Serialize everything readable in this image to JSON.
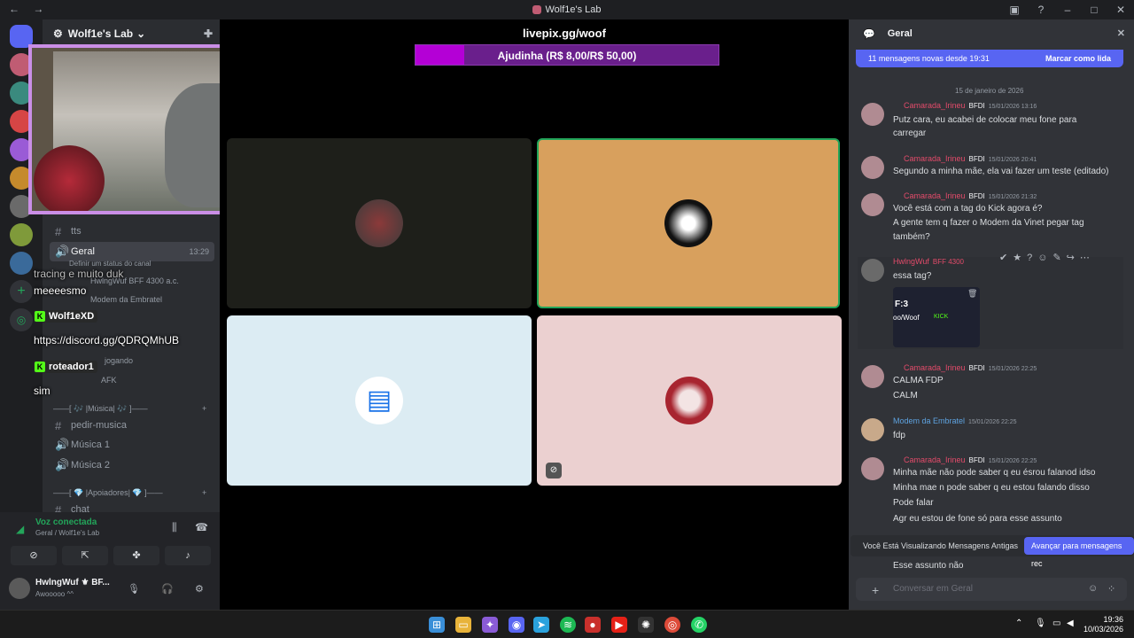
{
  "window": {
    "title": "Wolf1e's Lab",
    "nav": "← →"
  },
  "server": {
    "name": "Wolf1e's Lab"
  },
  "channels": [
    {
      "name": "tts",
      "icon": "#",
      "time": ""
    },
    {
      "name": "Geral",
      "icon": "🔊",
      "time": "13:29",
      "status": "Definir um status do canal"
    },
    {
      "name": "pedir-musica",
      "icon": "#"
    },
    {
      "name": "Música 1",
      "icon": "🔊"
    },
    {
      "name": "Música 2",
      "icon": "🔊"
    },
    {
      "name": "chat",
      "icon": "#"
    }
  ],
  "members": {
    "m1": "HwlngWuf  BFF 4300 a.c.",
    "m2": "Modem da Embratel",
    "m3": "jogando",
    "m4": "AFK"
  },
  "categories": {
    "musica": "——[ 🎶 |Música| 🎶 ]——",
    "apoiadores": "——[ 💎 |Apoiadores| 💎 ]——"
  },
  "overlay_chat": {
    "line1": "tracing e muito duk",
    "line2": "meeeesmo",
    "user1": "Wolf1eXD",
    "line3": "https://discord.gg/QDRQMhUB",
    "user2": "roteador1",
    "line4": "sim"
  },
  "voice": {
    "status": "Voz conectada",
    "location": "Geral / Wolf1e's Lab"
  },
  "user": {
    "name": "HwlngWuf ⚜ BF...",
    "status": "Awooooo ^^"
  },
  "stage": {
    "title": "livepix.gg/woof",
    "goal_label": "Ajudinha (R$ 8,00/R$ 50,00)",
    "goal_progress": 0.16
  },
  "chat": {
    "channel": "Geral",
    "new_messages": "11 mensagens novas desde 19:31",
    "mark_read": "Marcar como lida",
    "date_sep": "15 de janeiro de 2026",
    "messages": [
      {
        "name": "Camarada_Irineu",
        "tag": "BFDI",
        "ts": "15/01/2026 13:16",
        "lines": [
          "Putz cara, eu acabei de colocar meu fone para",
          "carregar"
        ]
      },
      {
        "name": "Camarada_Irineu",
        "tag": "BFDI",
        "ts": "15/01/2026 20:41",
        "lines": [
          "Segundo a minha mãe, ela vai fazer um teste (editado)"
        ]
      },
      {
        "name": "Camarada_Irineu",
        "tag": "BFDI",
        "ts": "15/01/2026 21:32",
        "lines": [
          "Você está com a tag do Kick agora é?",
          "A gente tem q fazer o Modem da Vinet pegar tag",
          "também?"
        ]
      },
      {
        "name": "HwlngWuf",
        "tag": "BFF 4300",
        "ts": "",
        "lines": [
          "essa tag?"
        ]
      },
      {
        "name": "Camarada_Irineu",
        "tag": "BFDI",
        "ts": "15/01/2026 22:25",
        "lines": [
          "CALMA FDP",
          "CALM"
        ]
      },
      {
        "name": "Modem da Embratel",
        "tag": "",
        "ts": "15/01/2026 22:25",
        "lines": [
          "fdp"
        ]
      },
      {
        "name": "Camarada_Irineu",
        "tag": "BFDI",
        "ts": "15/01/2026 22:25",
        "lines": [
          "Minha mãe não pode saber q eu ésrou falanod idso",
          "Minha mae n pode saber q eu estou falando disso",
          "Pode falar",
          "Agr eu estou de fone só para esse assunto"
        ]
      }
    ],
    "embed": {
      "a": "F:3",
      "b": "oo/Woof",
      "c": "KICK"
    },
    "old_notice": "Você Está Visualizando Mensagens Antigas",
    "jump": "Avançar para mensagens rec",
    "last_line": "Esse assunto não",
    "placeholder": "Conversar em  Geral"
  },
  "clock": {
    "time": "19:36",
    "date": "10/03/2026"
  },
  "colors": {
    "accent": "#5865f2",
    "goal_fill": "#b400d6",
    "kick": "#53fc18"
  }
}
